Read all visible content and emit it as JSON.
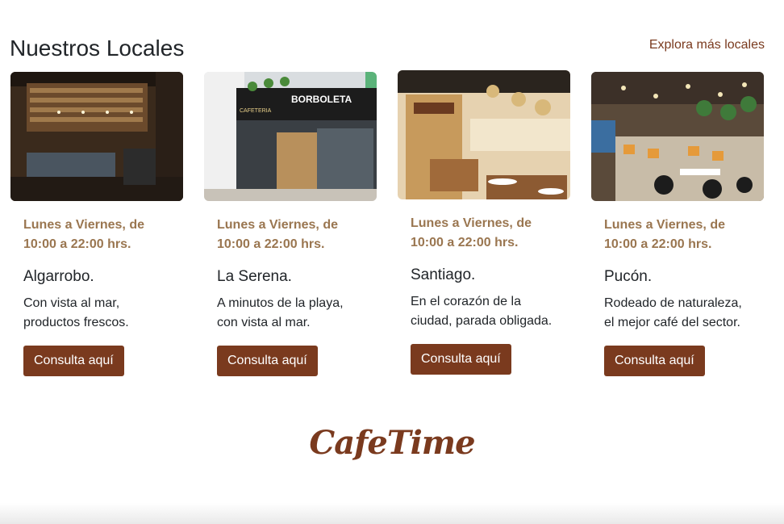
{
  "section": {
    "title": "Nuestros Locales",
    "explore_link": "Explora más locales"
  },
  "cards": [
    {
      "image_name": "cafe-interior-algarrobo",
      "hours_line1": "Lunes a Viernes, de",
      "hours_line2": "10:00 a 22:00 hrs.",
      "place": "Algarrobo.",
      "desc_line1": "Con vista al mar,",
      "desc_line2": "productos frescos.",
      "button": "Consulta aquí"
    },
    {
      "image_name": "cafe-storefront-la-serena",
      "hours_line1": "Lunes a Viernes, de",
      "hours_line2": "10:00 a 22:00 hrs.",
      "place": "La Serena.",
      "desc_line1": "A minutos de la playa,",
      "desc_line2": "con vista al mar.",
      "button": "Consulta aquí"
    },
    {
      "image_name": "cafe-interior-santiago",
      "hours_line1": "Lunes a Viernes, de",
      "hours_line2": "10:00 a 22:00 hrs.",
      "place": "Santiago.",
      "desc_line1": "En el corazón de la",
      "desc_line2": "ciudad, parada obligada.",
      "button": "Consulta aquí"
    },
    {
      "image_name": "cafe-interior-pucon",
      "hours_line1": "Lunes a Viernes, de",
      "hours_line2": "10:00 a 22:00 hrs.",
      "place": "Pucón.",
      "desc_line1": "Rodeado de naturaleza,",
      "desc_line2": "el mejor café del sector.",
      "button": "Consulta aquí"
    }
  ],
  "footer": {
    "logo": "CafeTime"
  },
  "colors": {
    "brand": "#7a3a1e",
    "hours": "#9a7650"
  }
}
